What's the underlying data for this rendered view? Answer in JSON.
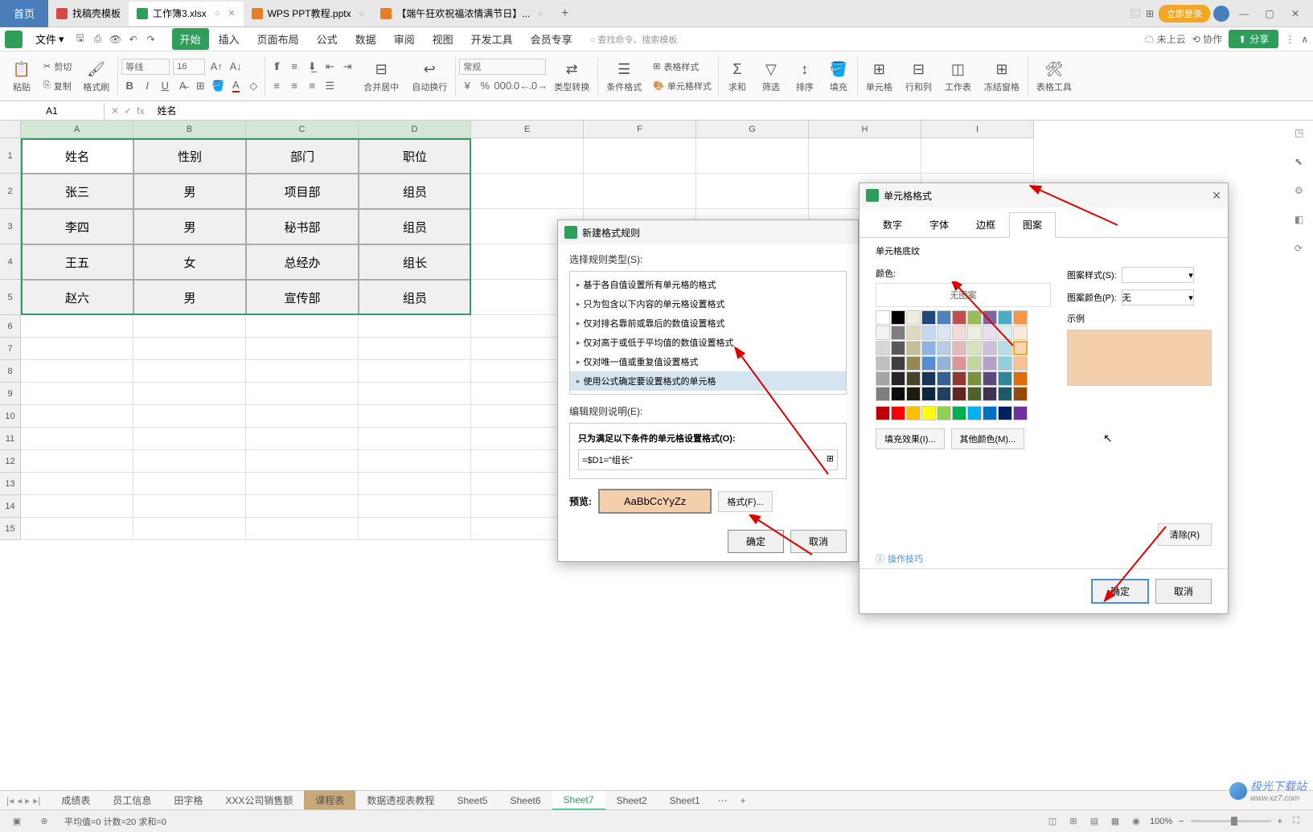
{
  "titlebar": {
    "home": "首页",
    "tabs": [
      {
        "label": "找稿壳模板",
        "icon": "red"
      },
      {
        "label": "工作簿3.xlsx",
        "icon": "green",
        "active": true
      },
      {
        "label": "WPS PPT教程.pptx",
        "icon": "orange"
      },
      {
        "label": "【端午狂欢祝福浓情满节日】...",
        "icon": "orange"
      }
    ],
    "login": "立即登录"
  },
  "menubar": {
    "file": "文件",
    "items": [
      "开始",
      "插入",
      "页面布局",
      "公式",
      "数据",
      "审阅",
      "视图",
      "开发工具",
      "会员专享"
    ],
    "search_hint": "查找命令、搜索模板",
    "cloud": "未上云",
    "coop": "协作",
    "share": "分享"
  },
  "ribbon": {
    "paste": "粘贴",
    "cut": "剪切",
    "copy": "复制",
    "format_painter": "格式刷",
    "font": "等线",
    "font_size": "16",
    "merge": "合并居中",
    "wrap": "自动换行",
    "number_format": "常规",
    "type_convert": "类型转换",
    "cond_format": "条件格式",
    "table_format": "表格样式",
    "cell_style": "单元格样式",
    "sum": "求和",
    "filter": "筛选",
    "sort": "排序",
    "fill": "填充",
    "cell": "单元格",
    "rowcol": "行和列",
    "worksheet": "工作表",
    "freeze": "冻结窗格",
    "table_tools": "表格工具"
  },
  "formulabar": {
    "name": "A1",
    "fx": "fx",
    "value": "姓名"
  },
  "columns": [
    "A",
    "B",
    "C",
    "D",
    "E",
    "F",
    "G",
    "H",
    "I"
  ],
  "rows": [
    "1",
    "2",
    "3",
    "4",
    "5",
    "6",
    "7",
    "8",
    "9",
    "10",
    "11",
    "12",
    "13",
    "14",
    "15"
  ],
  "table": {
    "headers": [
      "姓名",
      "性别",
      "部门",
      "职位"
    ],
    "rows": [
      [
        "张三",
        "男",
        "项目部",
        "组员"
      ],
      [
        "李四",
        "男",
        "秘书部",
        "组员"
      ],
      [
        "王五",
        "女",
        "总经办",
        "组长"
      ],
      [
        "赵六",
        "男",
        "宣传部",
        "组员"
      ]
    ]
  },
  "dialog1": {
    "title": "新建格式规则",
    "select_label": "选择规则类型(S):",
    "rules": [
      "基于各自值设置所有单元格的格式",
      "只为包含以下内容的单元格设置格式",
      "仅对排名靠前或靠后的数值设置格式",
      "仅对高于或低于平均值的数值设置格式",
      "仅对唯一值或重复值设置格式",
      "使用公式确定要设置格式的单元格"
    ],
    "edit_label": "编辑规则说明(E):",
    "condition_label": "只为满足以下条件的单元格设置格式(O):",
    "formula": "=$D1=\"组长\"",
    "preview_label": "预览:",
    "preview_text": "AaBbCcYyZz",
    "format_btn": "格式(F)...",
    "ok": "确定",
    "cancel": "取消"
  },
  "dialog2": {
    "title": "单元格格式",
    "tabs": [
      "数字",
      "字体",
      "边框",
      "图案"
    ],
    "section_label": "单元格底纹",
    "color_label": "颜色:",
    "no_pattern": "无图案",
    "pattern_style": "图案样式(S):",
    "pattern_color": "图案颜色(P):",
    "pattern_color_value": "无",
    "sample_label": "示例",
    "fill_effects": "填充效果(I)...",
    "more_colors": "其他颜色(M)...",
    "clear": "清除(R)",
    "tips": "操作技巧",
    "ok": "确定",
    "cancel": "取消",
    "sample_color": "#f5ceab",
    "colors_row1": [
      "#ffffff",
      "#000000",
      "#eeece1",
      "#1f497d",
      "#4f81bd",
      "#c0504d",
      "#9bbb59",
      "#8064a2",
      "#4bacc6",
      "#f79646"
    ],
    "colors_row2": [
      "#f2f2f2",
      "#7f7f7f",
      "#ddd9c3",
      "#c6d9f0",
      "#dbe5f1",
      "#f2dcdb",
      "#ebf1dd",
      "#e5e0ec",
      "#dbeef3",
      "#fdeada"
    ],
    "colors_row3": [
      "#d8d8d8",
      "#595959",
      "#c4bd97",
      "#8db3e2",
      "#b8cce4",
      "#e5b9b7",
      "#d7e3bc",
      "#ccc1d9",
      "#b7dde8",
      "#fbd5b5"
    ],
    "colors_row4": [
      "#bfbfbf",
      "#3f3f3f",
      "#938953",
      "#548dd4",
      "#95b3d7",
      "#d99694",
      "#c3d69b",
      "#b2a2c7",
      "#92cddc",
      "#fac08f"
    ],
    "colors_row5": [
      "#a5a5a5",
      "#262626",
      "#494429",
      "#17365d",
      "#366092",
      "#953734",
      "#76923c",
      "#5f497a",
      "#31859b",
      "#e36c09"
    ],
    "colors_row6": [
      "#7f7f7f",
      "#0c0c0c",
      "#1d1b10",
      "#0f243e",
      "#244061",
      "#632423",
      "#4f6128",
      "#3f3151",
      "#205867",
      "#974806"
    ],
    "colors_std": [
      "#c00000",
      "#ff0000",
      "#ffc000",
      "#ffff00",
      "#92d050",
      "#00b050",
      "#00b0f0",
      "#0070c0",
      "#002060",
      "#7030a0"
    ]
  },
  "sheettabs": {
    "tabs": [
      "成绩表",
      "员工信息",
      "田字格",
      "XXX公司销售额",
      "课程表",
      "数据透视表教程",
      "Sheet5",
      "Sheet6",
      "Sheet7",
      "Sheet2",
      "Sheet1"
    ],
    "active": "Sheet7",
    "highlight": "课程表"
  },
  "statusbar": {
    "stats": "平均值=0  计数=20  求和=0",
    "zoom": "100%"
  },
  "watermark": {
    "text": "极光下载站",
    "url": "www.xz7.com"
  }
}
